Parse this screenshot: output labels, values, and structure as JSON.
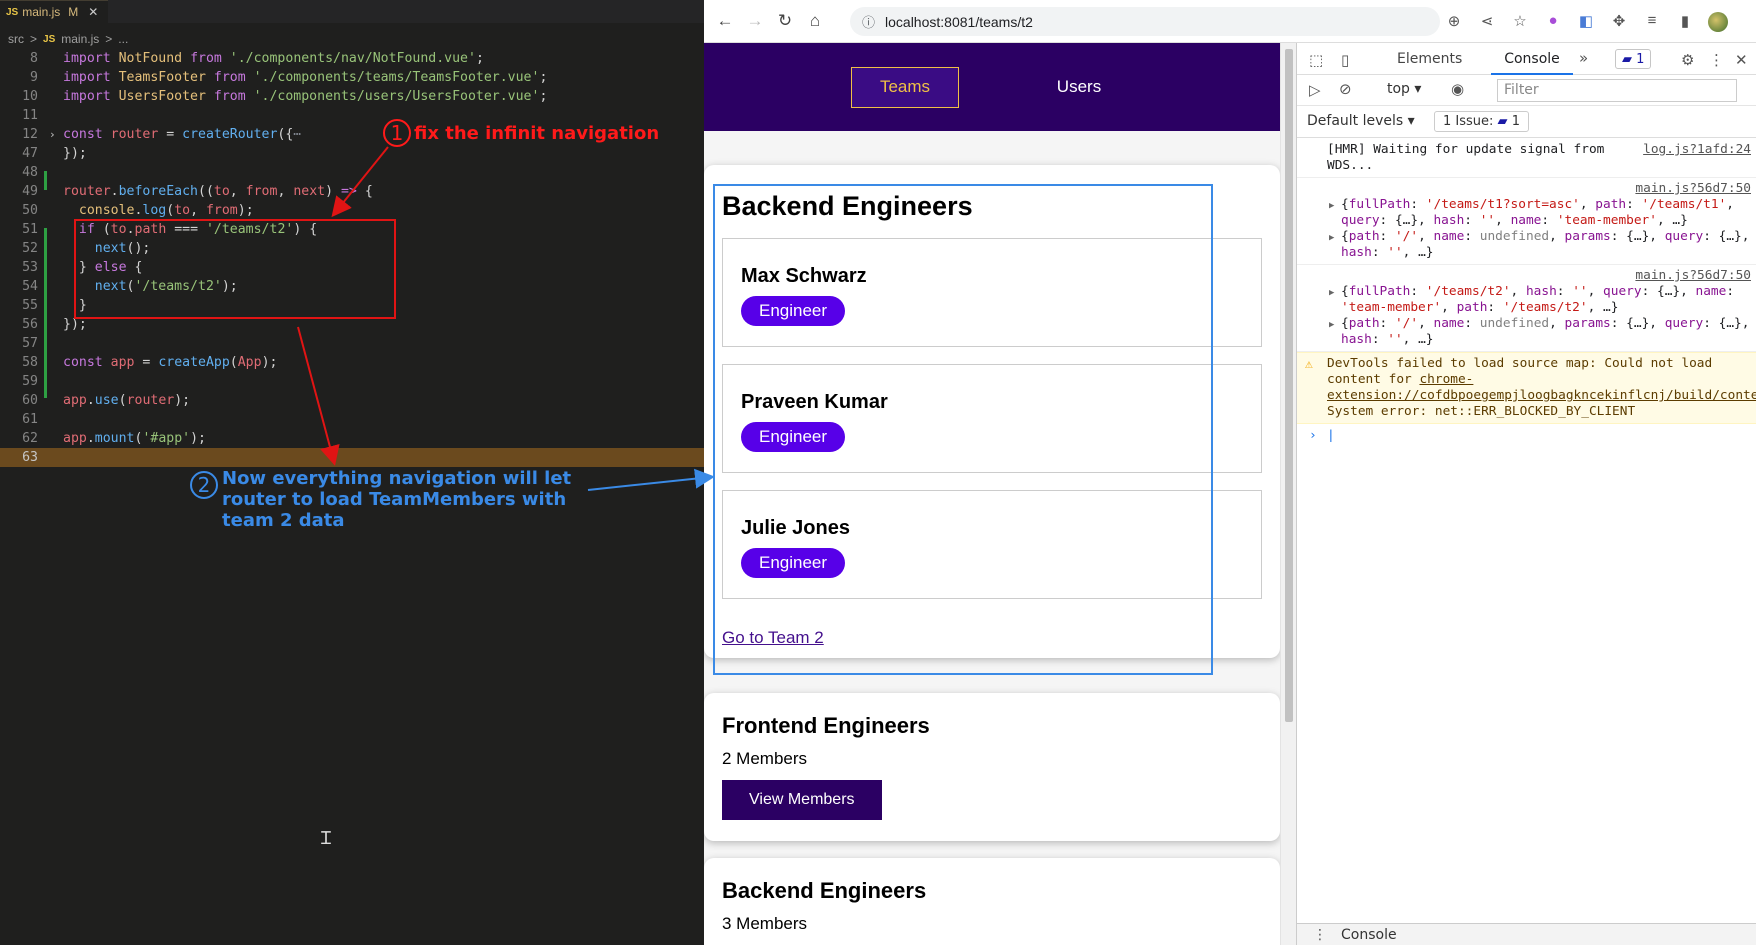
{
  "editor": {
    "tab": {
      "icon": "JS",
      "filename": "main.js",
      "modified": "M",
      "close": "✕"
    },
    "breadcrumb": {
      "folder": "src",
      "sep": ">",
      "icon": "JS",
      "file": "main.js",
      "sep2": ">",
      "rest": "..."
    },
    "lines": [
      {
        "n": "8"
      },
      {
        "n": "9"
      },
      {
        "n": "10"
      },
      {
        "n": "11"
      },
      {
        "n": "12"
      },
      {
        "n": "47"
      },
      {
        "n": "48"
      },
      {
        "n": "49"
      },
      {
        "n": "50"
      },
      {
        "n": "51"
      },
      {
        "n": "52"
      },
      {
        "n": "53"
      },
      {
        "n": "54"
      },
      {
        "n": "55"
      },
      {
        "n": "56"
      },
      {
        "n": "57"
      },
      {
        "n": "58"
      },
      {
        "n": "59"
      },
      {
        "n": "60"
      },
      {
        "n": "61"
      },
      {
        "n": "62"
      },
      {
        "n": "63"
      }
    ]
  },
  "annotations": {
    "a1": {
      "num": "1",
      "text": "fix the infinit navigation",
      "color": "#ff1a1a"
    },
    "a2": {
      "num": "2",
      "text": "Now everything navigation will let router to load TeamMembers with team 2 data",
      "color": "#3a8ae6"
    }
  },
  "browser": {
    "url_host": "localhost:8081",
    "url_path": "/teams/t2",
    "nav": {
      "back": "←",
      "forward": "→",
      "reload": "↻",
      "home": "⌂",
      "info": "ⓘ"
    },
    "toolbar_icons": [
      "zoom-icon",
      "share-icon",
      "star-icon",
      "extension-lb-icon",
      "translate-icon",
      "puzzle-icon",
      "media-icon",
      "sidepanel-icon"
    ]
  },
  "app": {
    "nav": [
      {
        "label": "Teams",
        "active": true
      },
      {
        "label": "Users",
        "active": false
      }
    ],
    "team_members_card": {
      "title": "Backend Engineers",
      "members": [
        {
          "name": "Max Schwarz",
          "role": "Engineer"
        },
        {
          "name": "Praveen Kumar",
          "role": "Engineer"
        },
        {
          "name": "Julie Jones",
          "role": "Engineer"
        }
      ],
      "link": "Go to Team 2"
    },
    "teams": [
      {
        "name": "Frontend Engineers",
        "count": "2 Members",
        "button": "View Members"
      },
      {
        "name": "Backend Engineers",
        "count": "3 Members"
      }
    ]
  },
  "devtools": {
    "tabs": {
      "elements": "Elements",
      "console": "Console",
      "more": "»",
      "messages": "1"
    },
    "context": "top",
    "filter_placeholder": "Filter",
    "levels": "Default levels",
    "issues": "1 Issue:",
    "issues_count": "1",
    "drawer": "Console",
    "logs": {
      "hmr": {
        "text": "[HMR] Waiting for update signal from WDS...",
        "src": "log.js?1afd:24"
      }
    }
  }
}
